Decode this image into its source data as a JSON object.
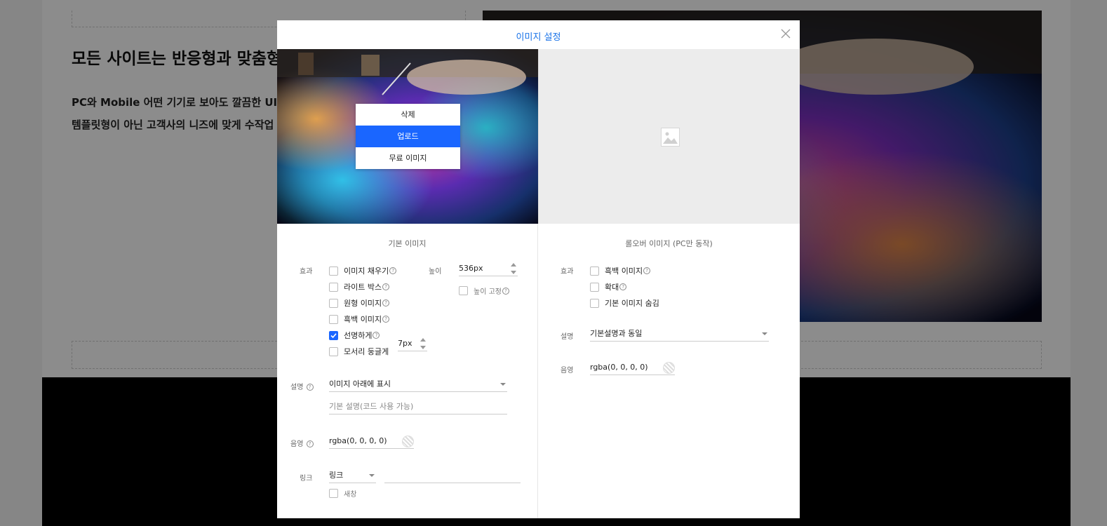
{
  "background": {
    "heading": "모든 사이트는 반응형과 맞춤형",
    "paragraph_line1": "PC와 Mobile 어떤 기기로 보아도 깔끔한 UI로",
    "paragraph_line2": "템플릿형이 아닌 고객사의 니즈에 맞게 수작업"
  },
  "modal": {
    "title": "이미지 설정",
    "context_menu": [
      "삭제",
      "업로드",
      "무료 이미지"
    ],
    "basic": {
      "section_title": "기본 이미지",
      "effect_label": "효과",
      "options": {
        "fill": "이미지 채우기",
        "lightbox": "라이트 박스",
        "circle": "원형 이미지",
        "grayscale": "흑백 이미지",
        "sharpen": "선명하게",
        "rounded": "모서리 둥글게"
      },
      "radius_value": "7px",
      "height_label": "높이",
      "height_value": "536px",
      "height_fixed": "높이 고정",
      "caption_label": "설명",
      "caption_value": "이미지 아래에 표시",
      "caption_placeholder": "기본 설명(코드 사용 가능)",
      "shadow_label": "음영",
      "shadow_value": "rgba(0, 0, 0, 0)",
      "link_label": "링크",
      "link_type": "링크",
      "new_window": "새창"
    },
    "rollover": {
      "section_title": "롤오버 이미지 (PC만 동작)",
      "effect_label": "효과",
      "options": {
        "grayscale": "흑백 이미지",
        "zoom": "확대",
        "hide_basic": "기본 이미지 숨김"
      },
      "caption_label": "설명",
      "caption_value": "기본설명과 동일",
      "shadow_label": "음영",
      "shadow_value": "rgba(0, 0, 0, 0)"
    }
  },
  "colors": {
    "accent": "#1a66ff",
    "title_blue": "#1a73e8"
  }
}
